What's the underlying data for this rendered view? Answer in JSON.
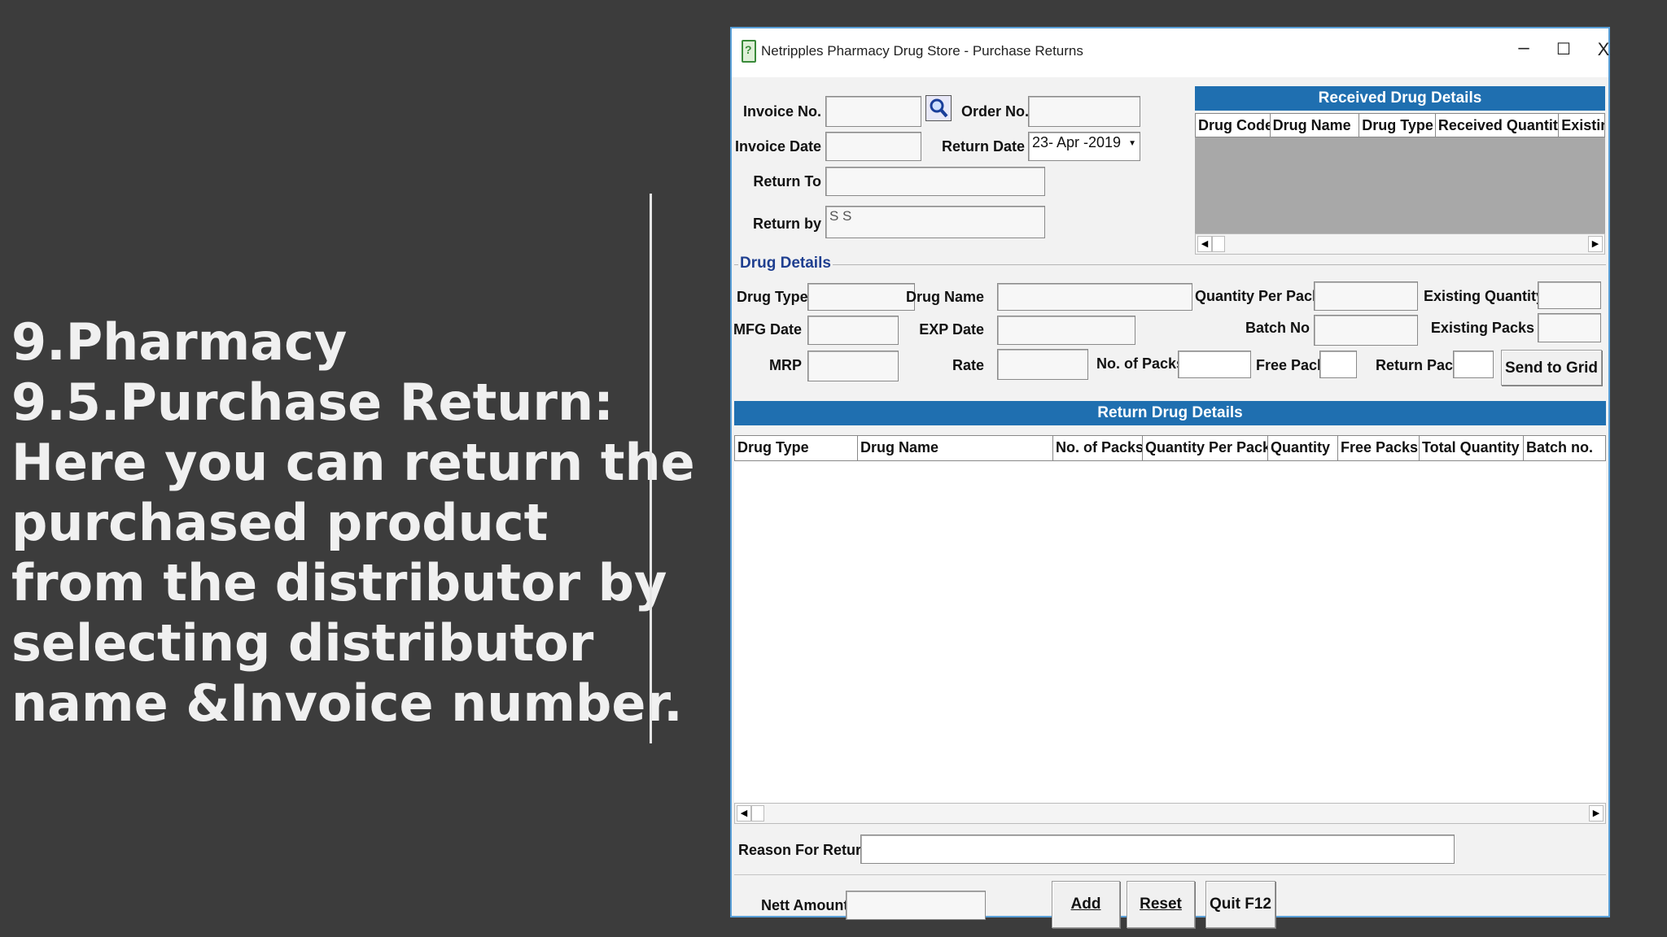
{
  "slide": {
    "lines": [
      "9.Pharmacy",
      "9.5.Purchase Return:",
      "Here you can return the",
      "purchased product",
      "from the distributor by",
      "selecting distributor",
      "name &Invoice number."
    ]
  },
  "window": {
    "title": "Netripples Pharmacy Drug Store - Purchase Returns",
    "minimize": "–",
    "maximize": "☐",
    "close": "X"
  },
  "header_form": {
    "invoice_no_label": "Invoice No.",
    "order_no_label": "Order No.",
    "invoice_date_label": "Invoice Date",
    "return_date_label": "Return Date",
    "return_date_value": "23- Apr -2019",
    "return_to_label": "Return To",
    "return_by_label": "Return by",
    "return_by_value": "S S"
  },
  "received_grid": {
    "title": "Received Drug Details",
    "columns": [
      "Drug Code",
      "Drug Name",
      "Drug Type",
      "Received Quantity",
      "Existin"
    ]
  },
  "drug_details": {
    "group_title": "Drug Details",
    "drug_type_label": "Drug Type",
    "drug_name_label": "Drug Name",
    "qty_per_pack_label": "Quantity Per Pack",
    "existing_qty_label": "Existing Quantity",
    "mfg_date_label": "MFG Date",
    "exp_date_label": "EXP Date",
    "batch_no_label": "Batch No",
    "existing_packs_label": "Existing Packs",
    "mrp_label": "MRP",
    "rate_label": "Rate",
    "no_of_packs_label": "No. of Packs",
    "free_pack_label": "Free Pack",
    "return_pack_label": "Return Pack",
    "send_to_grid_label": "Send to Grid"
  },
  "return_grid": {
    "title": "Return Drug Details",
    "columns": [
      "Drug Type",
      "Drug Name",
      "No. of Packs",
      "Quantity Per Pack",
      "Quantity",
      "Free Packs",
      "Total Quantity",
      "Batch no."
    ]
  },
  "footer": {
    "reason_label": "Reason For Return",
    "nett_amount_label": "Nett Amount",
    "add_label": "Add",
    "reset_label": "Reset",
    "quit_label": "Quit F12"
  },
  "colors": {
    "background": "#3c3c3c",
    "header_blue": "#1f6fb0",
    "window_border": "#5aa0d8"
  }
}
